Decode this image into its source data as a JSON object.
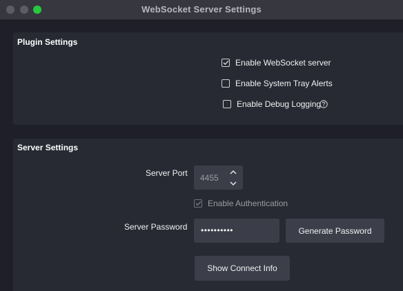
{
  "window": {
    "title": "WebSocket Server Settings"
  },
  "plugin_settings": {
    "title": "Plugin Settings",
    "enable_websocket_server": {
      "label": "Enable WebSocket server",
      "checked": true
    },
    "enable_system_tray_alerts": {
      "label": "Enable System Tray Alerts",
      "checked": false
    },
    "enable_debug_logging": {
      "label": "Enable Debug Logging",
      "checked": false,
      "help_icon": "question-circle-icon"
    }
  },
  "server_settings": {
    "title": "Server Settings",
    "server_port": {
      "label": "Server Port",
      "value": "4455"
    },
    "enable_authentication": {
      "label": "Enable Authentication",
      "checked": true,
      "disabled": true
    },
    "server_password": {
      "label": "Server Password",
      "value": "••••••••••"
    },
    "generate_password_label": "Generate Password",
    "show_connect_info_label": "Show Connect Info"
  },
  "colors": {
    "window_background": "#1e1f29",
    "group_background": "#272a33",
    "control_background": "#3b3e48",
    "titlebar": "#37373f",
    "zoom_button": "#27c93f"
  }
}
